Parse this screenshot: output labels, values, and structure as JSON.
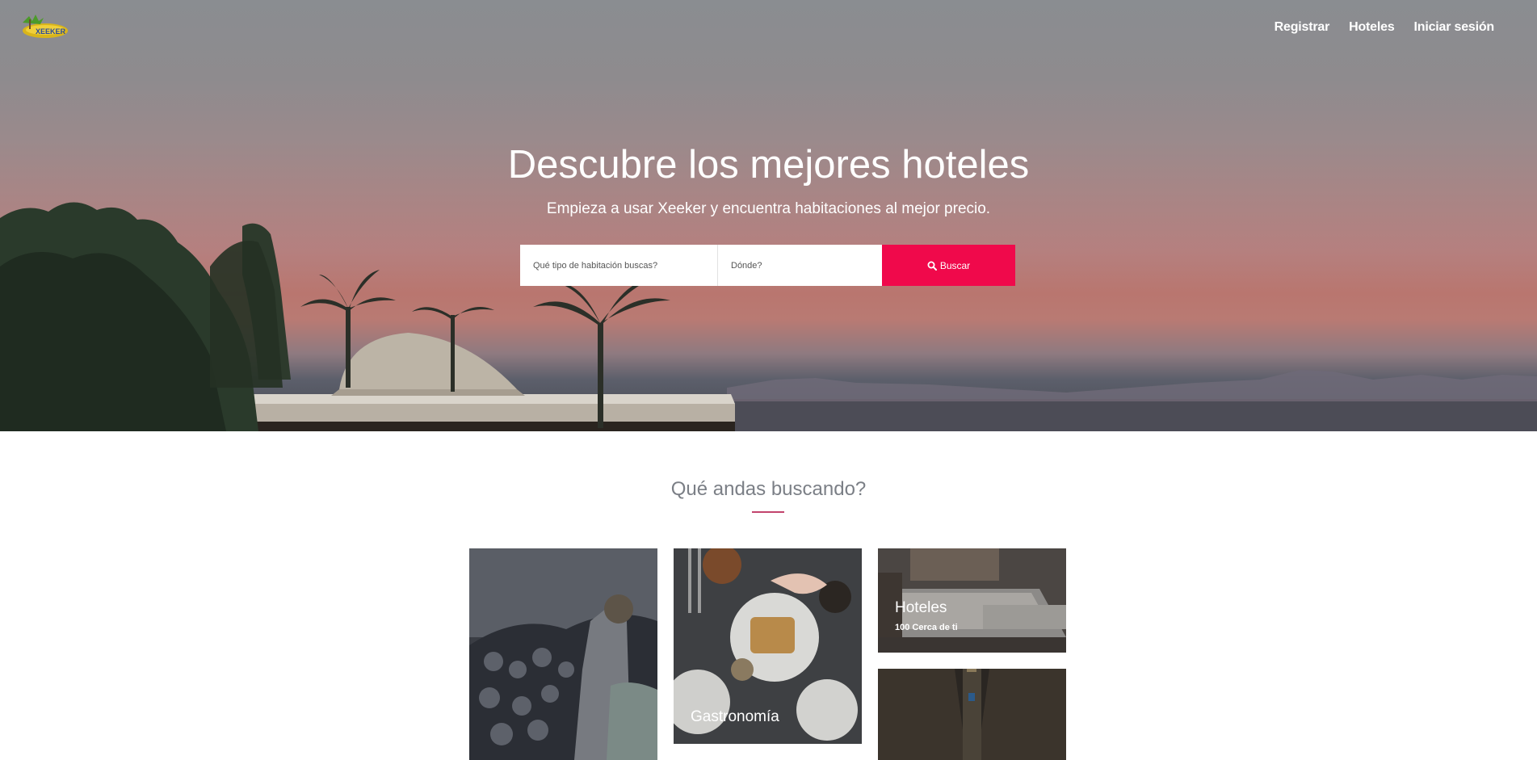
{
  "nav": {
    "items": [
      "Registrar",
      "Hoteles",
      "Iniciar sesión"
    ]
  },
  "hero": {
    "title": "Descubre los mejores hoteles",
    "subtitle": "Empieza a usar Xeeker y encuentra habitaciones al mejor precio."
  },
  "search": {
    "type_placeholder": "Qué tipo de habitación buscas?",
    "where_placeholder": "Dónde?",
    "button_label": "Buscar",
    "button_icon": "search-icon"
  },
  "section": {
    "title": "Qué andas buscando?"
  },
  "cards": {
    "gastronomia": {
      "title": "Gastronomía"
    },
    "hoteles": {
      "title": "Hoteles",
      "subtitle": "100 Cerca de ti"
    }
  },
  "colors": {
    "accent": "#f0094b",
    "underline": "#c2446d",
    "section_title": "#7b7f86"
  }
}
